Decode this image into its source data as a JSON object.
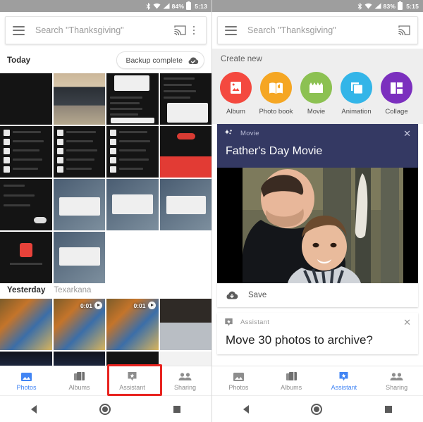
{
  "left": {
    "statusbar": {
      "bluetooth": "bluetooth-icon",
      "wifi": "wifi-icon",
      "signal": "signal-icon",
      "battery_pct": "84%",
      "time": "5:13"
    },
    "search": {
      "placeholder": "Search \"Thanksgiving\"",
      "menu_icon": "hamburger-icon",
      "cast_icon": "cast-icon",
      "overflow_icon": "overflow-menu-icon"
    },
    "today": {
      "title": "Today",
      "chip_label": "Backup complete",
      "chip_icon": "cloud-check-icon"
    },
    "yesterday": {
      "title": "Yesterday",
      "location": "Texarkana"
    },
    "videos": [
      {
        "duration": "0:01"
      },
      {
        "duration": "0:01"
      }
    ],
    "nav": [
      {
        "label": "Photos",
        "icon": "photos-icon",
        "active": true
      },
      {
        "label": "Albums",
        "icon": "albums-icon",
        "active": false
      },
      {
        "label": "Assistant",
        "icon": "assistant-icon",
        "active": false
      },
      {
        "label": "Sharing",
        "icon": "sharing-icon",
        "active": false
      }
    ],
    "system": {
      "back": "back-icon",
      "home": "home-icon",
      "recents": "recents-icon"
    },
    "annotation": {
      "color": "#e8231f",
      "target": "Assistant"
    }
  },
  "right": {
    "statusbar": {
      "bluetooth": "bluetooth-icon",
      "wifi": "wifi-icon",
      "signal": "signal-icon",
      "battery_pct": "83%",
      "time": "5:15"
    },
    "search": {
      "placeholder": "Search \"Thanksgiving\"",
      "menu_icon": "hamburger-icon",
      "cast_icon": "cast-icon"
    },
    "create": {
      "title": "Create new",
      "items": [
        {
          "label": "Album",
          "color": "#f4493f",
          "icon": "album-icon"
        },
        {
          "label": "Photo book",
          "color": "#f5a623",
          "icon": "photo-book-icon"
        },
        {
          "label": "Movie",
          "color": "#8cc152",
          "icon": "movie-clapper-icon"
        },
        {
          "label": "Animation",
          "color": "#33b5e8",
          "icon": "animation-icon"
        },
        {
          "label": "Collage",
          "color": "#7b2fbe",
          "icon": "collage-icon"
        }
      ]
    },
    "movie_card": {
      "kind": "Movie",
      "kind_icon": "sparkle-icon",
      "title": "Father's Day Movie",
      "close_icon": "close-icon",
      "save_label": "Save",
      "save_icon": "cloud-download-icon"
    },
    "assistant_card": {
      "kind": "Assistant",
      "kind_icon": "assistant-badge-icon",
      "title": "Move 30 photos to archive?",
      "close_icon": "close-icon"
    },
    "nav": [
      {
        "label": "Photos",
        "icon": "photos-icon",
        "active": false
      },
      {
        "label": "Albums",
        "icon": "albums-icon",
        "active": false
      },
      {
        "label": "Assistant",
        "icon": "assistant-icon",
        "active": true
      },
      {
        "label": "Sharing",
        "icon": "sharing-icon",
        "active": false
      }
    ],
    "system": {
      "back": "back-icon",
      "home": "home-icon",
      "recents": "recents-icon"
    }
  }
}
